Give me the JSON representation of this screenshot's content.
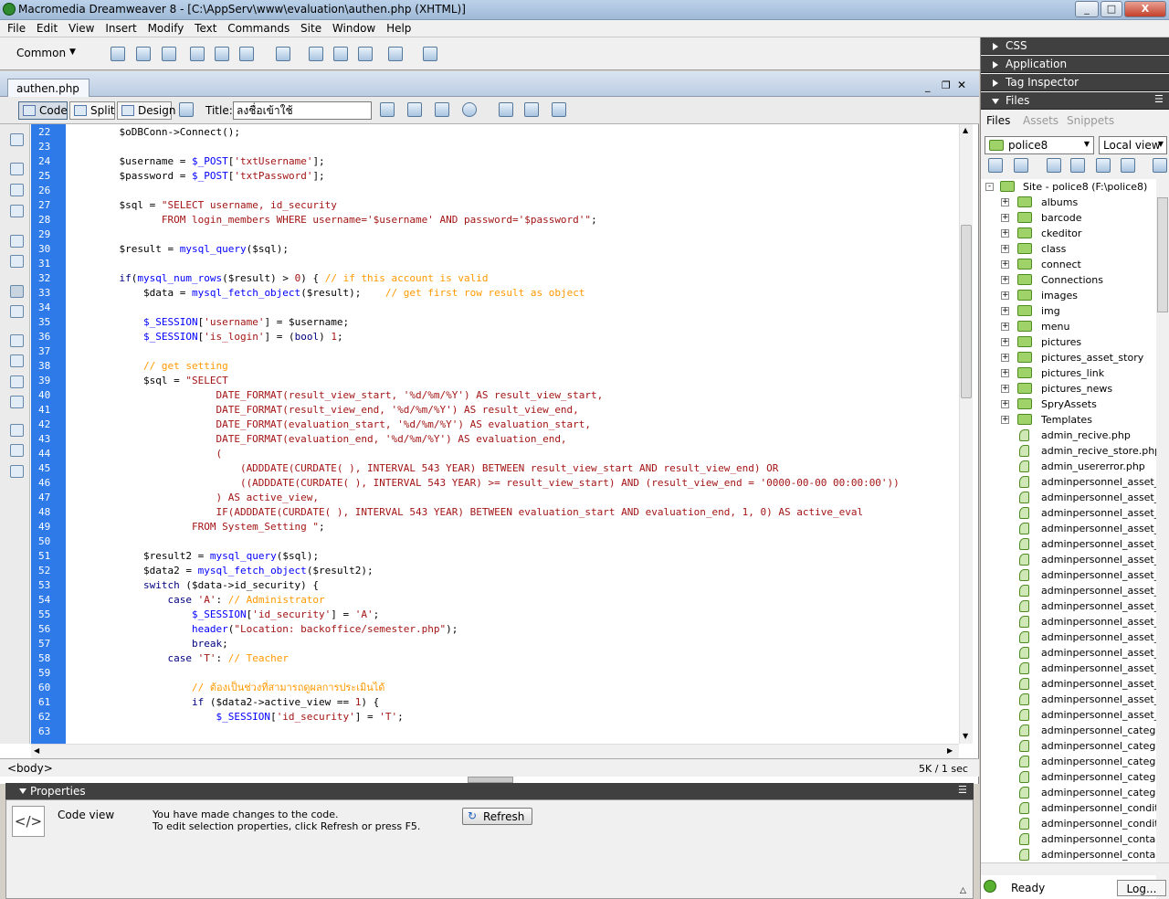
{
  "window": {
    "title": "Macromedia Dreamweaver 8 - [C:\\AppServ\\www\\evaluation\\authen.php (XHTML)]",
    "min": "_",
    "max": "□",
    "close": "X"
  },
  "menu": [
    "File",
    "Edit",
    "View",
    "Insert",
    "Modify",
    "Text",
    "Commands",
    "Site",
    "Window",
    "Help"
  ],
  "insert_bar": {
    "category": "Common",
    "chevron": "▼"
  },
  "document": {
    "tab": "authen.php",
    "view_buttons": {
      "code": "Code",
      "split": "Split",
      "design": "Design"
    },
    "title_label": "Title:",
    "title_value": "ลงชื่อเข้าใช้",
    "tag": "<body>",
    "status": "5K / 1 sec"
  },
  "code_lines": [
    {
      "n": "22",
      "parts": [
        [
          "v",
          "    $oDBConn->Connect();"
        ]
      ]
    },
    {
      "n": "23",
      "parts": []
    },
    {
      "n": "24",
      "parts": [
        [
          "v",
          "    $username = "
        ],
        [
          "f",
          "$_POST"
        ],
        [
          "v",
          "["
        ],
        [
          "s",
          "'txtUsername'"
        ],
        [
          "v",
          "];"
        ]
      ]
    },
    {
      "n": "25",
      "parts": [
        [
          "v",
          "    $password = "
        ],
        [
          "f",
          "$_POST"
        ],
        [
          "v",
          "["
        ],
        [
          "s",
          "'txtPassword'"
        ],
        [
          "v",
          "];"
        ]
      ]
    },
    {
      "n": "26",
      "parts": []
    },
    {
      "n": "27",
      "parts": [
        [
          "v",
          "    $sql = "
        ],
        [
          "s",
          "\"SELECT username, id_security"
        ]
      ]
    },
    {
      "n": "28",
      "parts": [
        [
          "s",
          "           FROM login_members WHERE username='$username' AND password='$password'\""
        ],
        [
          "v",
          ";"
        ]
      ]
    },
    {
      "n": "29",
      "parts": []
    },
    {
      "n": "30",
      "parts": [
        [
          "v",
          "    $result = "
        ],
        [
          "f",
          "mysql_query"
        ],
        [
          "v",
          "($sql);"
        ]
      ]
    },
    {
      "n": "31",
      "parts": []
    },
    {
      "n": "32",
      "parts": [
        [
          "k",
          "    if"
        ],
        [
          "v",
          "("
        ],
        [
          "f",
          "mysql_num_rows"
        ],
        [
          "v",
          "($result) > "
        ],
        [
          "s",
          "0"
        ],
        [
          "v",
          ") { "
        ],
        [
          "c",
          "// if this account is valid"
        ]
      ]
    },
    {
      "n": "33",
      "parts": [
        [
          "v",
          "        $data = "
        ],
        [
          "f",
          "mysql_fetch_object"
        ],
        [
          "v",
          "($result);    "
        ],
        [
          "c",
          "// get first row result as object"
        ]
      ]
    },
    {
      "n": "34",
      "parts": []
    },
    {
      "n": "35",
      "parts": [
        [
          "f",
          "        $_SESSION"
        ],
        [
          "v",
          "["
        ],
        [
          "s",
          "'username'"
        ],
        [
          "v",
          "] = $username;"
        ]
      ]
    },
    {
      "n": "36",
      "parts": [
        [
          "f",
          "        $_SESSION"
        ],
        [
          "v",
          "["
        ],
        [
          "s",
          "'is_login'"
        ],
        [
          "v",
          "] = ("
        ],
        [
          "k",
          "bool"
        ],
        [
          "v",
          ") "
        ],
        [
          "s",
          "1"
        ],
        [
          "v",
          ";"
        ]
      ]
    },
    {
      "n": "37",
      "parts": []
    },
    {
      "n": "38",
      "parts": [
        [
          "c",
          "        // get setting"
        ]
      ]
    },
    {
      "n": "39",
      "parts": [
        [
          "v",
          "        $sql = "
        ],
        [
          "s",
          "\"SELECT"
        ]
      ]
    },
    {
      "n": "40",
      "parts": [
        [
          "s",
          "                    DATE_FORMAT(result_view_start, '%d/%m/%Y') AS result_view_start,"
        ]
      ]
    },
    {
      "n": "41",
      "parts": [
        [
          "s",
          "                    DATE_FORMAT(result_view_end, '%d/%m/%Y') AS result_view_end,"
        ]
      ]
    },
    {
      "n": "42",
      "parts": [
        [
          "s",
          "                    DATE_FORMAT(evaluation_start, '%d/%m/%Y') AS evaluation_start,"
        ]
      ]
    },
    {
      "n": "43",
      "parts": [
        [
          "s",
          "                    DATE_FORMAT(evaluation_end, '%d/%m/%Y') AS evaluation_end,"
        ]
      ]
    },
    {
      "n": "44",
      "parts": [
        [
          "s",
          "                    ("
        ]
      ]
    },
    {
      "n": "45",
      "parts": [
        [
          "s",
          "                        (ADDDATE(CURDATE( ), INTERVAL 543 YEAR) BETWEEN result_view_start AND result_view_end) OR"
        ]
      ]
    },
    {
      "n": "46",
      "parts": [
        [
          "s",
          "                        ((ADDDATE(CURDATE( ), INTERVAL 543 YEAR) >= result_view_start) AND (result_view_end = '0000-00-00 00:00:00'))"
        ]
      ]
    },
    {
      "n": "47",
      "parts": [
        [
          "s",
          "                    ) AS active_view,"
        ]
      ]
    },
    {
      "n": "48",
      "parts": [
        [
          "s",
          "                    IF(ADDDATE(CURDATE( ), INTERVAL 543 YEAR) BETWEEN evaluation_start AND evaluation_end, 1, 0) AS active_eval"
        ]
      ]
    },
    {
      "n": "49",
      "parts": [
        [
          "s",
          "                FROM System_Setting \""
        ],
        [
          "v",
          ";"
        ]
      ]
    },
    {
      "n": "50",
      "parts": []
    },
    {
      "n": "51",
      "parts": [
        [
          "v",
          "        $result2 = "
        ],
        [
          "f",
          "mysql_query"
        ],
        [
          "v",
          "($sql);"
        ]
      ]
    },
    {
      "n": "52",
      "parts": [
        [
          "v",
          "        $data2 = "
        ],
        [
          "f",
          "mysql_fetch_object"
        ],
        [
          "v",
          "($result2);"
        ]
      ]
    },
    {
      "n": "53",
      "parts": [
        [
          "k",
          "        switch"
        ],
        [
          "v",
          " ($data->id_security) {"
        ]
      ]
    },
    {
      "n": "54",
      "parts": [
        [
          "k",
          "            case"
        ],
        [
          "s",
          " 'A'"
        ],
        [
          "v",
          ": "
        ],
        [
          "c",
          "// Administrator"
        ]
      ]
    },
    {
      "n": "55",
      "parts": [
        [
          "f",
          "                $_SESSION"
        ],
        [
          "v",
          "["
        ],
        [
          "s",
          "'id_security'"
        ],
        [
          "v",
          "] = "
        ],
        [
          "s",
          "'A'"
        ],
        [
          "v",
          ";"
        ]
      ]
    },
    {
      "n": "56",
      "parts": [
        [
          "f",
          "                header"
        ],
        [
          "v",
          "("
        ],
        [
          "s",
          "\"Location: backoffice/semester.php\""
        ],
        [
          "v",
          ");"
        ]
      ]
    },
    {
      "n": "57",
      "parts": [
        [
          "k",
          "                break"
        ],
        [
          "v",
          ";"
        ]
      ]
    },
    {
      "n": "58",
      "parts": [
        [
          "k",
          "            case"
        ],
        [
          "s",
          " 'T'"
        ],
        [
          "v",
          ": "
        ],
        [
          "c",
          "// Teacher"
        ]
      ]
    },
    {
      "n": "59",
      "parts": []
    },
    {
      "n": "60",
      "parts": [
        [
          "c",
          "                // ต้องเป็นช่วงที่สามารถดูผลการประเมินได้"
        ]
      ]
    },
    {
      "n": "61",
      "parts": [
        [
          "k",
          "                if"
        ],
        [
          "v",
          " ($data2->active_view == "
        ],
        [
          "s",
          "1"
        ],
        [
          "v",
          ") {"
        ]
      ]
    },
    {
      "n": "62",
      "parts": [
        [
          "f",
          "                    $_SESSION"
        ],
        [
          "v",
          "["
        ],
        [
          "s",
          "'id_security'"
        ],
        [
          "v",
          "] = "
        ],
        [
          "s",
          "'T'"
        ],
        [
          "v",
          ";"
        ]
      ]
    },
    {
      "n": "63",
      "parts": []
    }
  ],
  "properties": {
    "header": "Properties",
    "view_label": "Code view",
    "message_line1": "You have made changes to the code.",
    "message_line2": "To edit selection properties, click Refresh or press F5.",
    "refresh": "Refresh"
  },
  "panels": {
    "css": "CSS",
    "application": "Application",
    "tag_inspector": "Tag Inspector",
    "files": "Files"
  },
  "files_panel": {
    "tabs": [
      "Files",
      "Assets",
      "Snippets"
    ],
    "site": "police8",
    "view": "Local view",
    "root": "Site - police8 (F:\\police8)",
    "folders": [
      "albums",
      "barcode",
      "ckeditor",
      "class",
      "connect",
      "Connections",
      "images",
      "img",
      "menu",
      "pictures",
      "pictures_asset_story",
      "pictures_link",
      "pictures_news",
      "SpryAssets",
      "Templates"
    ],
    "files": [
      "admin_recive.php",
      "admin_recive_store.php",
      "admin_usererror.php",
      "adminpersonnel_asset_ac",
      "adminpersonnel_asset_ac",
      "adminpersonnel_asset_de",
      "adminpersonnel_asset_de",
      "adminpersonnel_asset_ec",
      "adminpersonnel_asset_ec",
      "adminpersonnel_asset_nc",
      "adminpersonnel_asset_nc",
      "adminpersonnel_asset_re",
      "adminpersonnel_asset_re",
      "adminpersonnel_asset_sh",
      "adminpersonnel_asset_ty",
      "adminpersonnel_asset_ty",
      "adminpersonnel_asset_ty",
      "adminpersonnel_asset_ty",
      "adminpersonnel_asset_ty",
      "adminpersonnel_category",
      "adminpersonnel_category",
      "adminpersonnel_category",
      "adminpersonnel_category",
      "adminpersonnel_category",
      "adminpersonnel_conditior",
      "adminpersonnel_conditior",
      "adminpersonnel_contact.",
      "adminpersonnel_contact_"
    ],
    "status": "Ready",
    "log": "Log..."
  }
}
